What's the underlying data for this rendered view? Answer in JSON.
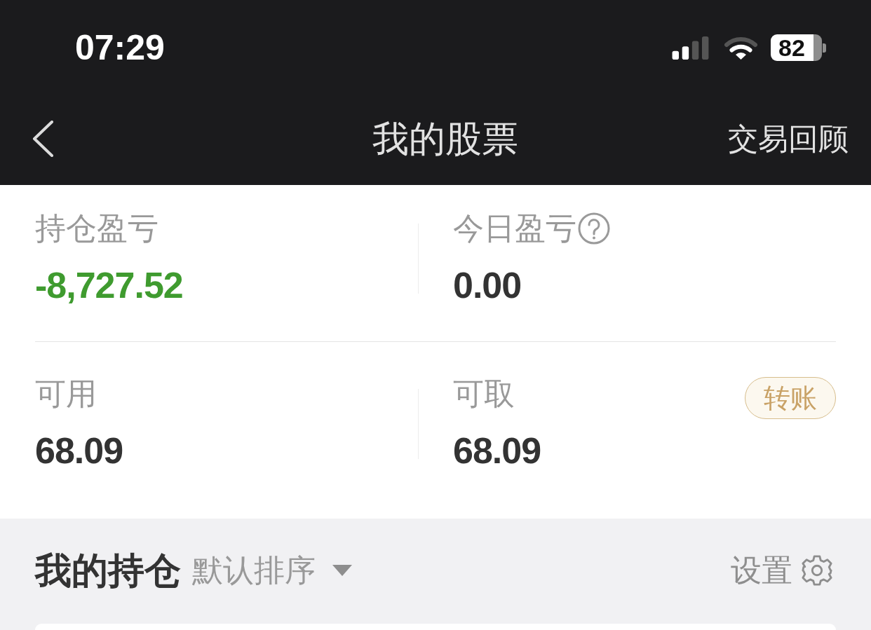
{
  "status_bar": {
    "time": "07:29",
    "battery": "82"
  },
  "nav_bar": {
    "title": "我的股票",
    "action": "交易回顾"
  },
  "summary": [
    {
      "cells": [
        {
          "label": "持仓盈亏",
          "value": "-8,727.52",
          "color": "#3f9b2f",
          "help": false
        },
        {
          "label": "今日盈亏",
          "value": "0.00",
          "color": "#333333",
          "help": true
        }
      ]
    },
    {
      "cells": [
        {
          "label": "可用",
          "value": "68.09",
          "color": "#333333",
          "help": false
        },
        {
          "label": "可取",
          "value": "68.09",
          "color": "#333333",
          "help": false,
          "button": "转账"
        }
      ]
    }
  ],
  "holdings": {
    "title": "我的持仓",
    "sort": "默认排序",
    "settings": "设置"
  }
}
